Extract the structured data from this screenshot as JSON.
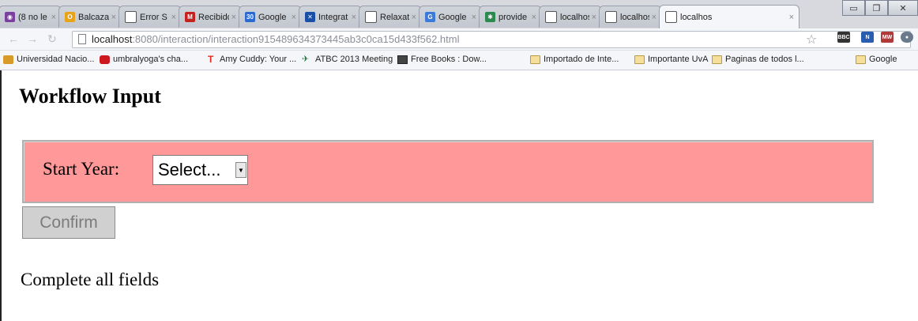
{
  "browser": {
    "tabs": [
      {
        "label": "(8 no le",
        "icon": "chat-bubble-icon",
        "color": "#7b3fa0"
      },
      {
        "label": "Balcazar",
        "icon": "o-logo-icon",
        "color": "#e8a317"
      },
      {
        "label": "Error S",
        "icon": "document-icon",
        "color": "#555555"
      },
      {
        "label": "Recibido",
        "icon": "gmail-icon",
        "color": "#c5221f"
      },
      {
        "label": "Google",
        "icon": "calendar-30-icon",
        "color": "#2a6ad2"
      },
      {
        "label": "Integrat",
        "icon": "x-logo-icon",
        "color": "#1a4fa8"
      },
      {
        "label": "Relaxat",
        "icon": "document-icon",
        "color": "#555555"
      },
      {
        "label": "Google",
        "icon": "translate-icon",
        "color": "#3b7ad8"
      },
      {
        "label": "provide",
        "icon": "puzzle-icon",
        "color": "#2d8a4e"
      },
      {
        "label": "localhos",
        "icon": "document-icon",
        "color": "#555555"
      },
      {
        "label": "localhos",
        "icon": "document-icon",
        "color": "#555555"
      },
      {
        "label": "localhos",
        "icon": "document-icon",
        "color": "#555555"
      }
    ],
    "address": {
      "host": "localhost",
      "rest": ":8080/interaction/interaction915489634373445ab3c0ca15d433f562.html"
    },
    "bookmarks": [
      {
        "label": "Universidad Nacio...",
        "icon": "university-icon"
      },
      {
        "label": "umbralyoga's cha...",
        "icon": "youtube-icon"
      },
      {
        "label": "Amy Cuddy: Your ...",
        "icon": "ted-icon"
      },
      {
        "label": "ATBC 2013 Meeting",
        "icon": "plane-icon"
      },
      {
        "label": "Free Books : Dow...",
        "icon": "library-icon"
      },
      {
        "label": "Importado de Inte...",
        "icon": "folder-icon"
      },
      {
        "label": "Importante UvA",
        "icon": "folder-icon"
      },
      {
        "label": "Paginas de todos l...",
        "icon": "folder-icon"
      },
      {
        "label": "Google",
        "icon": "folder-icon"
      }
    ],
    "extensions": [
      "BBC RADIO",
      "N",
      "MW",
      "ghost"
    ]
  },
  "page": {
    "heading": "Workflow Input",
    "start_year_label": "Start Year:",
    "start_year_value": "Select...",
    "confirm_label": "Confirm",
    "status_text": "Complete all fields"
  },
  "colors": {
    "panel_bg": "#ff9999",
    "confirm_disabled": "#d0d0d0"
  }
}
